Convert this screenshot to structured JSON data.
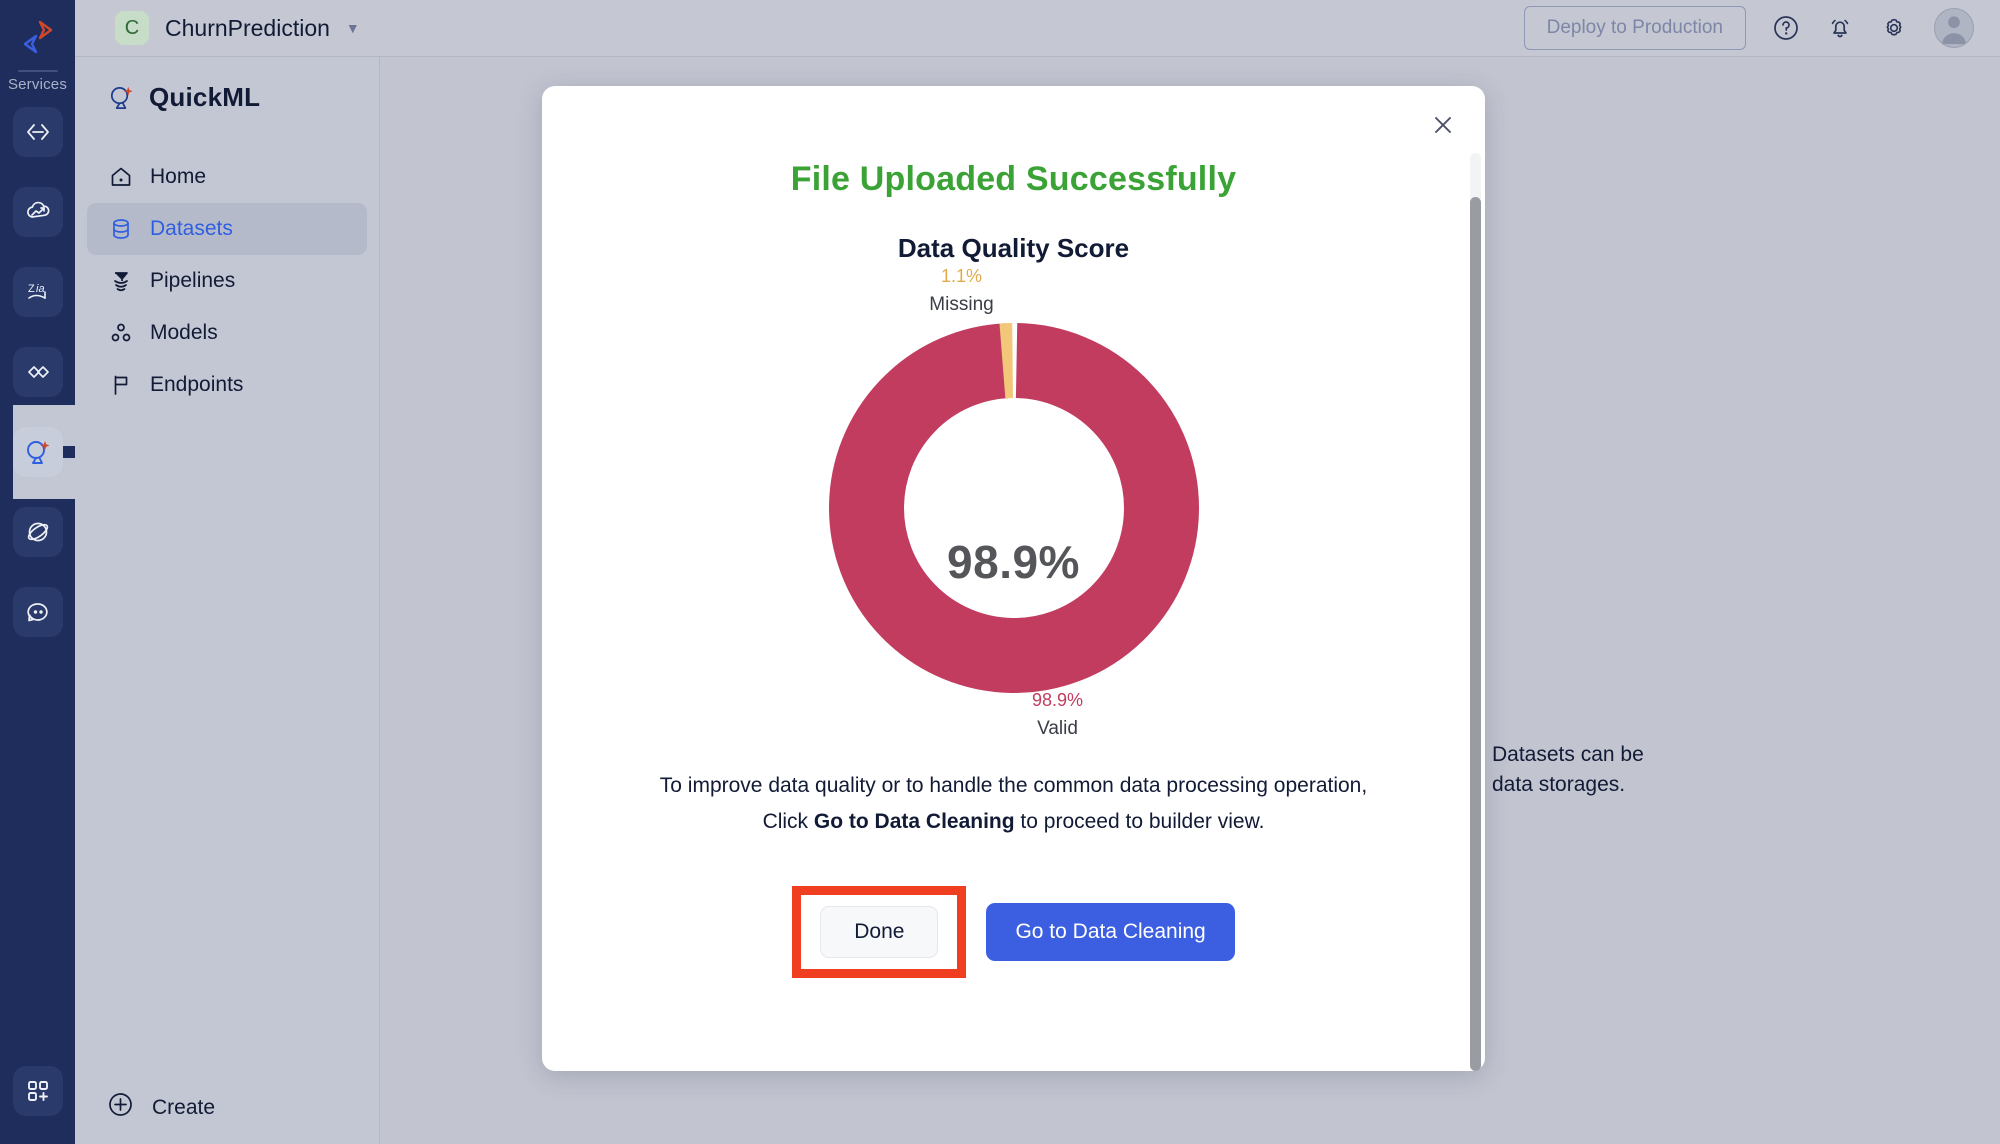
{
  "rail": {
    "services_label": "Services",
    "logo_icon": "zoho-logo-icon",
    "items": [
      {
        "icon": "code-brackets-icon",
        "name": "catalyst-code"
      },
      {
        "icon": "cloud-scale-icon",
        "name": "cloud-scale"
      },
      {
        "icon": "zia-icon",
        "name": "zia"
      },
      {
        "icon": "chevrons-icon",
        "name": "integrations"
      },
      {
        "icon": "quickml-sparkle-icon",
        "name": "quickml",
        "active": true
      },
      {
        "icon": "orbit-icon",
        "name": "orbit"
      },
      {
        "icon": "chat-bubble-icon",
        "name": "support-chat"
      }
    ],
    "bottom_icon": "apps-grid-plus-icon"
  },
  "topbar": {
    "project_initial": "C",
    "project_name": "ChurnPrediction",
    "caret_icon": "chevron-down-icon",
    "deploy_label": "Deploy to Production",
    "help_icon": "question-circle-icon",
    "bell_icon": "bell-icon",
    "gear_icon": "gear-icon",
    "avatar_icon": "user-avatar-icon"
  },
  "sidebar": {
    "product": "QuickML",
    "product_icon": "quickml-sparkle-icon",
    "items": [
      {
        "label": "Home",
        "icon": "home-icon",
        "active": false
      },
      {
        "label": "Datasets",
        "icon": "database-icon",
        "active": true
      },
      {
        "label": "Pipelines",
        "icon": "funnel-icon",
        "active": false
      },
      {
        "label": "Models",
        "icon": "models-nodes-icon",
        "active": false
      },
      {
        "label": "Endpoints",
        "icon": "flag-icon",
        "active": false
      }
    ],
    "create_label": "Create",
    "create_icon": "plus-circle-icon"
  },
  "canvas": {
    "hint_line1": "Datasets can be",
    "hint_line2": "data storages."
  },
  "modal": {
    "close_icon": "close-icon",
    "title": "File Uploaded Successfully",
    "subtitle": "Data Quality Score",
    "body_line1": "To improve data quality or to handle the common data processing operation,",
    "body_line2_pre": "Click ",
    "body_line2_bold": "Go to Data Cleaning",
    "body_line2_post": " to proceed to builder view.",
    "done_label": "Done",
    "clean_label": "Go to Data Cleaning",
    "highlight_color": "#ef3f20",
    "primary_color": "#3b5fe0",
    "title_color": "#3ba335"
  },
  "chart_data": {
    "type": "pie",
    "title": "Data Quality Score",
    "variant": "donut",
    "center_label": "98.9%",
    "categories": [
      "Valid",
      "Missing"
    ],
    "values": [
      98.9,
      1.1
    ],
    "colors": [
      "#c23c5f",
      "#f2c779"
    ],
    "labels": [
      {
        "name": "Missing",
        "value": "1.1%",
        "color": "#e2ab4b",
        "position": "top"
      },
      {
        "name": "Valid",
        "value": "98.9%",
        "color": "#c23c5f",
        "position": "bottom"
      }
    ],
    "legend": "none",
    "units": "percent"
  }
}
